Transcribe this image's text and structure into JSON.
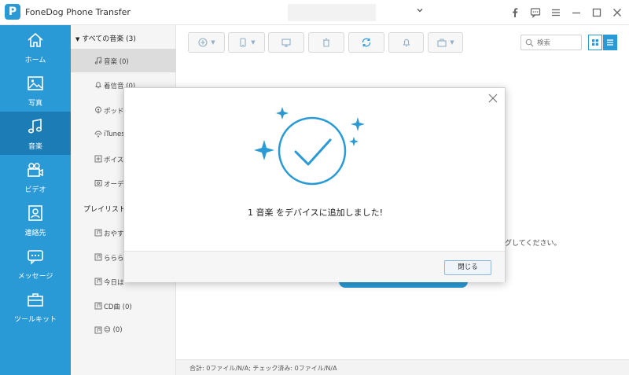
{
  "app": {
    "title": "FoneDog Phone Transfer",
    "logo_letter": "P",
    "accent_color": "#2a9ad6",
    "active_color": "#1b7cb6"
  },
  "window_icons": [
    "facebook-icon",
    "feedback-icon",
    "menu-icon",
    "minimize-icon",
    "maximize-icon",
    "close-icon"
  ],
  "sidebar": {
    "items": [
      {
        "label": "ホーム",
        "icon": "home-icon"
      },
      {
        "label": "写真",
        "icon": "photo-icon"
      },
      {
        "label": "音楽",
        "icon": "music-icon",
        "active": true
      },
      {
        "label": "ビデオ",
        "icon": "video-icon"
      },
      {
        "label": "連絡先",
        "icon": "contacts-icon"
      },
      {
        "label": "メッセージ",
        "icon": "message-icon"
      },
      {
        "label": "ツールキット",
        "icon": "toolkit-icon"
      }
    ]
  },
  "categories": {
    "header": "すべての音楽 (3)",
    "items": [
      {
        "label": "音楽 (0)",
        "icon": "music-note-icon"
      },
      {
        "label": "着信音 (0)",
        "icon": "bell-icon"
      },
      {
        "label": "ポッド",
        "icon": "podcast-icon"
      },
      {
        "label": "iTunes",
        "icon": "itunes-icon"
      },
      {
        "label": "ボイス",
        "icon": "voice-icon"
      },
      {
        "label": "オーデ",
        "icon": "audiobook-icon"
      }
    ],
    "playlist_header": "プレイリスト",
    "playlists": [
      {
        "label": "おやす"
      },
      {
        "label": "ららら"
      },
      {
        "label": "今日は"
      },
      {
        "label": "CD曲 (0)"
      },
      {
        "label": "😊 (0)"
      }
    ]
  },
  "toolbar": {
    "search_placeholder": "検索",
    "buttons": [
      "add-icon",
      "export-to-device-icon",
      "export-to-pc-icon",
      "delete-icon",
      "refresh-icon",
      "ringtone-icon",
      "toolbox-icon"
    ]
  },
  "main": {
    "hint": "ラッグしてください。"
  },
  "status": {
    "text": "合計: 0ファイル/N/A; チェック済み: 0ファイル/N/A"
  },
  "dialog": {
    "message": "1 音楽 をデバイスに追加しました!",
    "close_button": "閉じる"
  }
}
